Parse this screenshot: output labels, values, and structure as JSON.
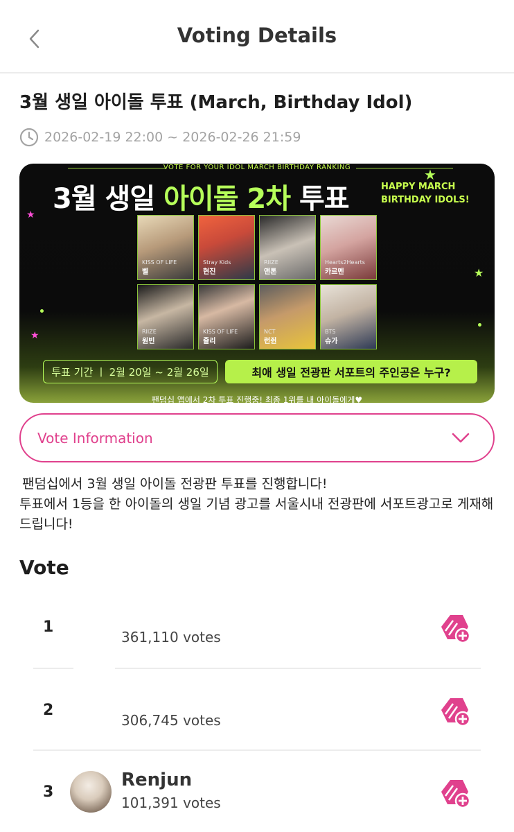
{
  "header": {
    "title": "Voting Details",
    "back_icon": "chevron-left-icon"
  },
  "vote": {
    "title": "3월 생일 아이돌 투표 (March, Birthday Idol)",
    "period": "2026-02-19 22:00 ~ 2026-02-26 21:59",
    "clock_icon": "clock-icon"
  },
  "banner": {
    "top_line": "VOTE FOR YOUR IDOL MARCH BIRTHDAY RANKING",
    "heading_white": "3월 생일 ",
    "heading_green": "아이돌 2차 ",
    "heading_white2": "투표",
    "happy_line1": "HAPPY MARCH",
    "happy_line2": "BIRTHDAY IDOLS!",
    "idols": [
      {
        "group": "KISS OF LIFE",
        "name": "벨"
      },
      {
        "group": "Stray Kids",
        "name": "현진"
      },
      {
        "group": "RIIZE",
        "name": "앤톤"
      },
      {
        "group": "Hearts2Hearts",
        "name": "카르멘"
      },
      {
        "group": "RIIZE",
        "name": "원빈"
      },
      {
        "group": "KISS OF LIFE",
        "name": "쥴리"
      },
      {
        "group": "NCT",
        "name": "런쥔"
      },
      {
        "group": "BTS",
        "name": "슈가"
      }
    ],
    "period_pill": "투표 기간  ㅣ  2월 20일 ~ 2월 26일",
    "cta_pill": "최애 생일 전광판 서포트의 주인공은 누구?",
    "footer": "팬덤십 앱에서 2차 투표 진행중! 최종 1위를 내 아이돌에게♥",
    "accent_color": "#b6ff5a"
  },
  "info": {
    "label": "Vote Information",
    "chevron_icon": "chevron-down-icon",
    "accent_color": "#e0418d"
  },
  "description": {
    "line1": "팬덤십에서 3월 생일 아이돌 전광판 투표를 진행합니다!",
    "line2": "투표에서 1등을 한 아이돌의 생일 기념 광고를 서울시내 전광판에 서포트광고로 게재해드립니다!"
  },
  "vote_section": {
    "heading": "Vote",
    "rankings": [
      {
        "rank": "1",
        "name": "",
        "votes": "361,110 votes",
        "icon": "vote-add-icon"
      },
      {
        "rank": "2",
        "name": "",
        "votes": "306,745 votes",
        "icon": "vote-add-icon"
      },
      {
        "rank": "3",
        "name": "Renjun",
        "votes": "101,391 votes",
        "icon": "vote-add-icon"
      }
    ]
  }
}
